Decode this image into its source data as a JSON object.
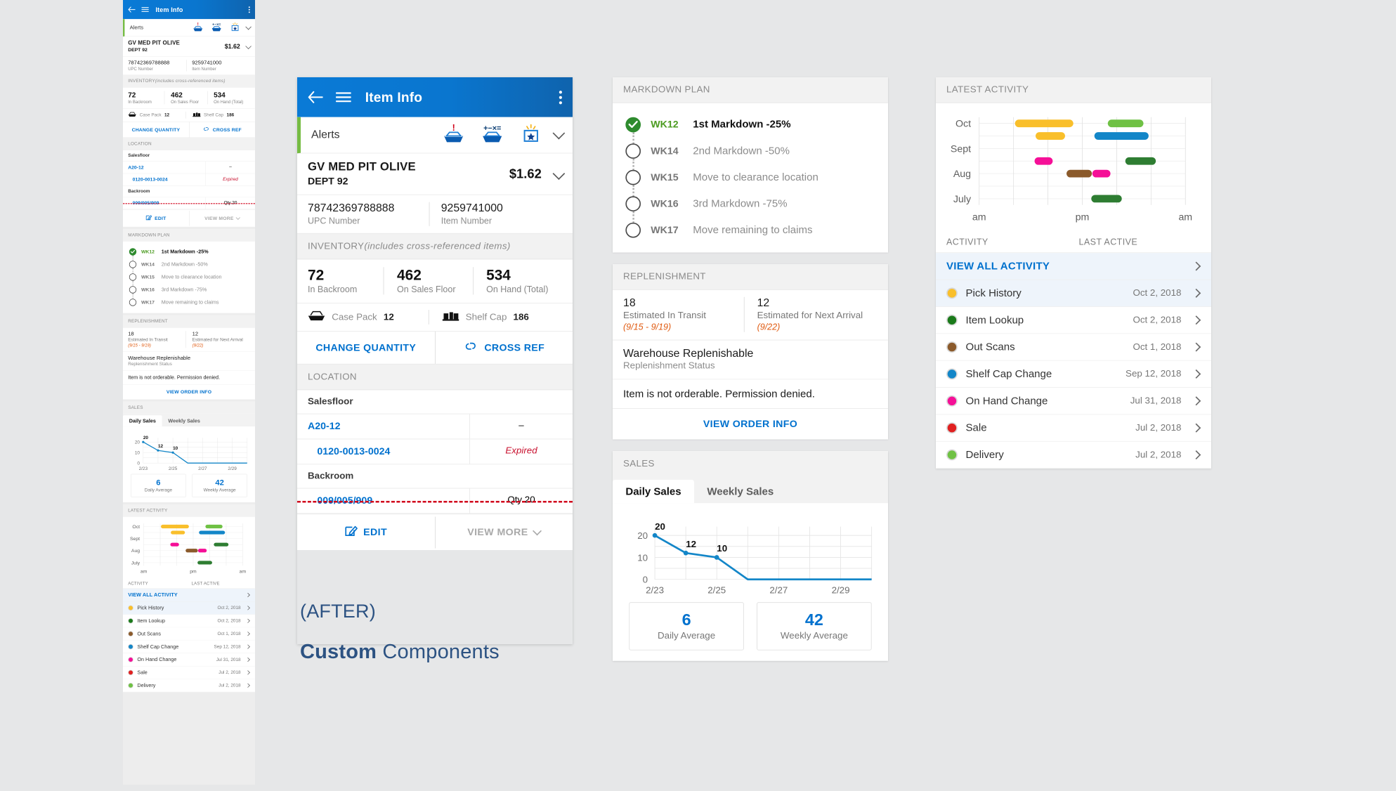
{
  "appbar": {
    "title": "Item Info",
    "back_icon": "back-arrow-icon",
    "menu_icon": "hamburger-icon",
    "overflow_icon": "kebab-menu-icon"
  },
  "alerts": {
    "label": "Alerts",
    "icons": [
      "tray-alert-icon",
      "tray-math-icon",
      "star-badge-icon"
    ],
    "expand_icon": "chevron-down-icon"
  },
  "item": {
    "name": "GV MED PIT OLIVE",
    "dept": "DEPT 92",
    "price": "$1.62",
    "upc_value": "78742369788888",
    "upc_label": "UPC Number",
    "item_value": "9259741000",
    "item_label": "Item Number"
  },
  "inventory": {
    "header_main": "INVENTORY ",
    "header_note": "(includes cross-referenced items)",
    "cells": [
      {
        "value": "72",
        "label": "In Backroom"
      },
      {
        "value": "462",
        "label": "On Sales Floor"
      },
      {
        "value": "534",
        "label": "On Hand (Total)"
      }
    ],
    "case_pack_label": "Case Pack",
    "case_pack_value": "12",
    "shelf_cap_label": "Shelf Cap",
    "shelf_cap_value": "186",
    "change_quantity": "CHANGE QUANTITY",
    "cross_ref": "CROSS REF"
  },
  "location": {
    "header": "LOCATION",
    "groups": [
      {
        "name": "Salesfloor",
        "rows": [
          {
            "code": "A20-12",
            "indent": false,
            "status": "–",
            "status_kind": "plain"
          },
          {
            "code": "0120-0013-0024",
            "indent": true,
            "status": "Expired",
            "status_kind": "expired"
          }
        ]
      },
      {
        "name": "Backroom",
        "rows": [
          {
            "code": "009/005/909",
            "indent": true,
            "status": "Qty 20",
            "status_kind": "plain"
          }
        ]
      }
    ],
    "edit_label": "EDIT",
    "edit_icon": "pencil-edit-icon",
    "view_more_label": "VIEW MORE",
    "view_more_icon": "chevron-down-icon"
  },
  "markdown": {
    "header": "MARKDOWN PLAN",
    "steps": [
      {
        "week": "WK12",
        "text": "1st Markdown -25%",
        "done": true
      },
      {
        "week": "WK14",
        "text": "2nd Markdown -50%",
        "done": false
      },
      {
        "week": "WK15",
        "text": "Move to clearance location",
        "done": false
      },
      {
        "week": "WK16",
        "text": "3rd Markdown -75%",
        "done": false
      },
      {
        "week": "WK17",
        "text": "Move remaining to claims",
        "done": false
      }
    ]
  },
  "replenishment": {
    "header": "REPLENISHMENT",
    "cells": [
      {
        "value": "18",
        "label": "Estimated In Transit",
        "dates": "(9/15 - 9/19)"
      },
      {
        "value": "12",
        "label": "Estimated for Next Arrival",
        "dates": "(9/22)"
      }
    ],
    "status_value": "Warehouse Replenishable",
    "status_label": "Replenishment Status",
    "message": "Item is not orderable. Permission denied.",
    "order_link": "VIEW ORDER INFO"
  },
  "sales": {
    "header": "SALES",
    "tabs": [
      {
        "label": "Daily Sales",
        "active": true
      },
      {
        "label": "Weekly Sales",
        "active": false
      }
    ],
    "daily_average_value": "6",
    "daily_average_label": "Daily Average",
    "weekly_average_value": "42",
    "weekly_average_label": "Weekly Average"
  },
  "latest_activity": {
    "header": "LATEST ACTIVITY",
    "col_activity": "ACTIVITY",
    "col_last_active": "LAST ACTIVE",
    "view_all": "VIEW ALL ACTIVITY",
    "items": [
      {
        "name": "Pick History",
        "date": "Oct 2, 2018",
        "color": "#f9bf2b",
        "highlight": true
      },
      {
        "name": "Item Lookup",
        "date": "Oct 2, 2018",
        "color": "#1a7a1a",
        "highlight": false
      },
      {
        "name": "Out Scans",
        "date": "Oct 1, 2018",
        "color": "#8b5a2b",
        "highlight": false
      },
      {
        "name": "Shelf Cap Change",
        "date": "Sep 12, 2018",
        "color": "#1386c8",
        "highlight": false
      },
      {
        "name": "On Hand Change",
        "date": "Jul 31, 2018",
        "color": "#f50f97",
        "highlight": false
      },
      {
        "name": "Sale",
        "date": "Jul 2, 2018",
        "color": "#e02020",
        "highlight": false
      },
      {
        "name": "Delivery",
        "date": "Jul 2, 2018",
        "color": "#6fc144",
        "highlight": false
      }
    ]
  },
  "caption": {
    "line1": "(AFTER)",
    "line2_bold": "Custom",
    "line2_rest": " Components"
  },
  "colors": {
    "brand_blue": "#0071ce",
    "appbar_blue": "#0a76cf",
    "accent_green": "#76bc43",
    "expired_red": "#c8102e",
    "date_orange": "#e05a10",
    "caption_blue": "#2c5282"
  },
  "chart_data": [
    {
      "id": "daily_sales_line",
      "type": "line",
      "title": "Daily Sales",
      "xlabel": "",
      "ylabel": "",
      "x": [
        "2/23",
        "2/24",
        "2/25",
        "2/26",
        "2/27",
        "2/28",
        "2/29",
        "3/1"
      ],
      "tick_labels": [
        "2/23",
        "2/25",
        "2/27",
        "2/29"
      ],
      "values": [
        20,
        12,
        10,
        0,
        0,
        0,
        0,
        0
      ],
      "point_labels": [
        {
          "x": "2/23",
          "y": 20,
          "label": "20"
        },
        {
          "x": "2/24",
          "y": 12,
          "label": "12"
        },
        {
          "x": "2/25",
          "y": 10,
          "label": "10"
        }
      ],
      "yticks": [
        0,
        10,
        20
      ],
      "ylim": [
        0,
        24
      ],
      "grid": true,
      "legend": "none",
      "series_color": "#1386c8"
    },
    {
      "id": "latest_activity_timeline",
      "type": "bar",
      "title": "LATEST ACTIVITY",
      "orientation": "horizontal",
      "ylabel": "",
      "xlabel": "",
      "ytick_labels": [
        "Oct",
        "Sept",
        "Aug",
        "July"
      ],
      "xtick_labels": [
        "am",
        "pm",
        "am"
      ],
      "grid": true,
      "legend": "none",
      "bars": [
        {
          "lane": 0,
          "start": 0.175,
          "end": 0.455,
          "color": "#f9bf2b",
          "activity": "Pick History"
        },
        {
          "lane": 0,
          "start": 0.625,
          "end": 0.795,
          "color": "#6fc144",
          "activity": "Delivery"
        },
        {
          "lane": 1,
          "start": 0.275,
          "end": 0.415,
          "color": "#f9bf2b",
          "activity": "Pick History"
        },
        {
          "lane": 1,
          "start": 0.56,
          "end": 0.82,
          "color": "#1386c8",
          "activity": "Shelf Cap Change"
        },
        {
          "lane": 3,
          "start": 0.27,
          "end": 0.355,
          "color": "#f50f97",
          "activity": "On Hand Change"
        },
        {
          "lane": 3,
          "start": 0.71,
          "end": 0.855,
          "color": "#2e7d32",
          "activity": "Item Lookup"
        },
        {
          "lane": 4,
          "start": 0.425,
          "end": 0.545,
          "color": "#8b5a2b",
          "activity": "Out Scans"
        },
        {
          "lane": 4,
          "start": 0.55,
          "end": 0.635,
          "color": "#f50f97",
          "activity": "On Hand Change"
        },
        {
          "lane": 6,
          "start": 0.545,
          "end": 0.69,
          "color": "#2e7d32",
          "activity": "Item Lookup"
        }
      ]
    }
  ]
}
